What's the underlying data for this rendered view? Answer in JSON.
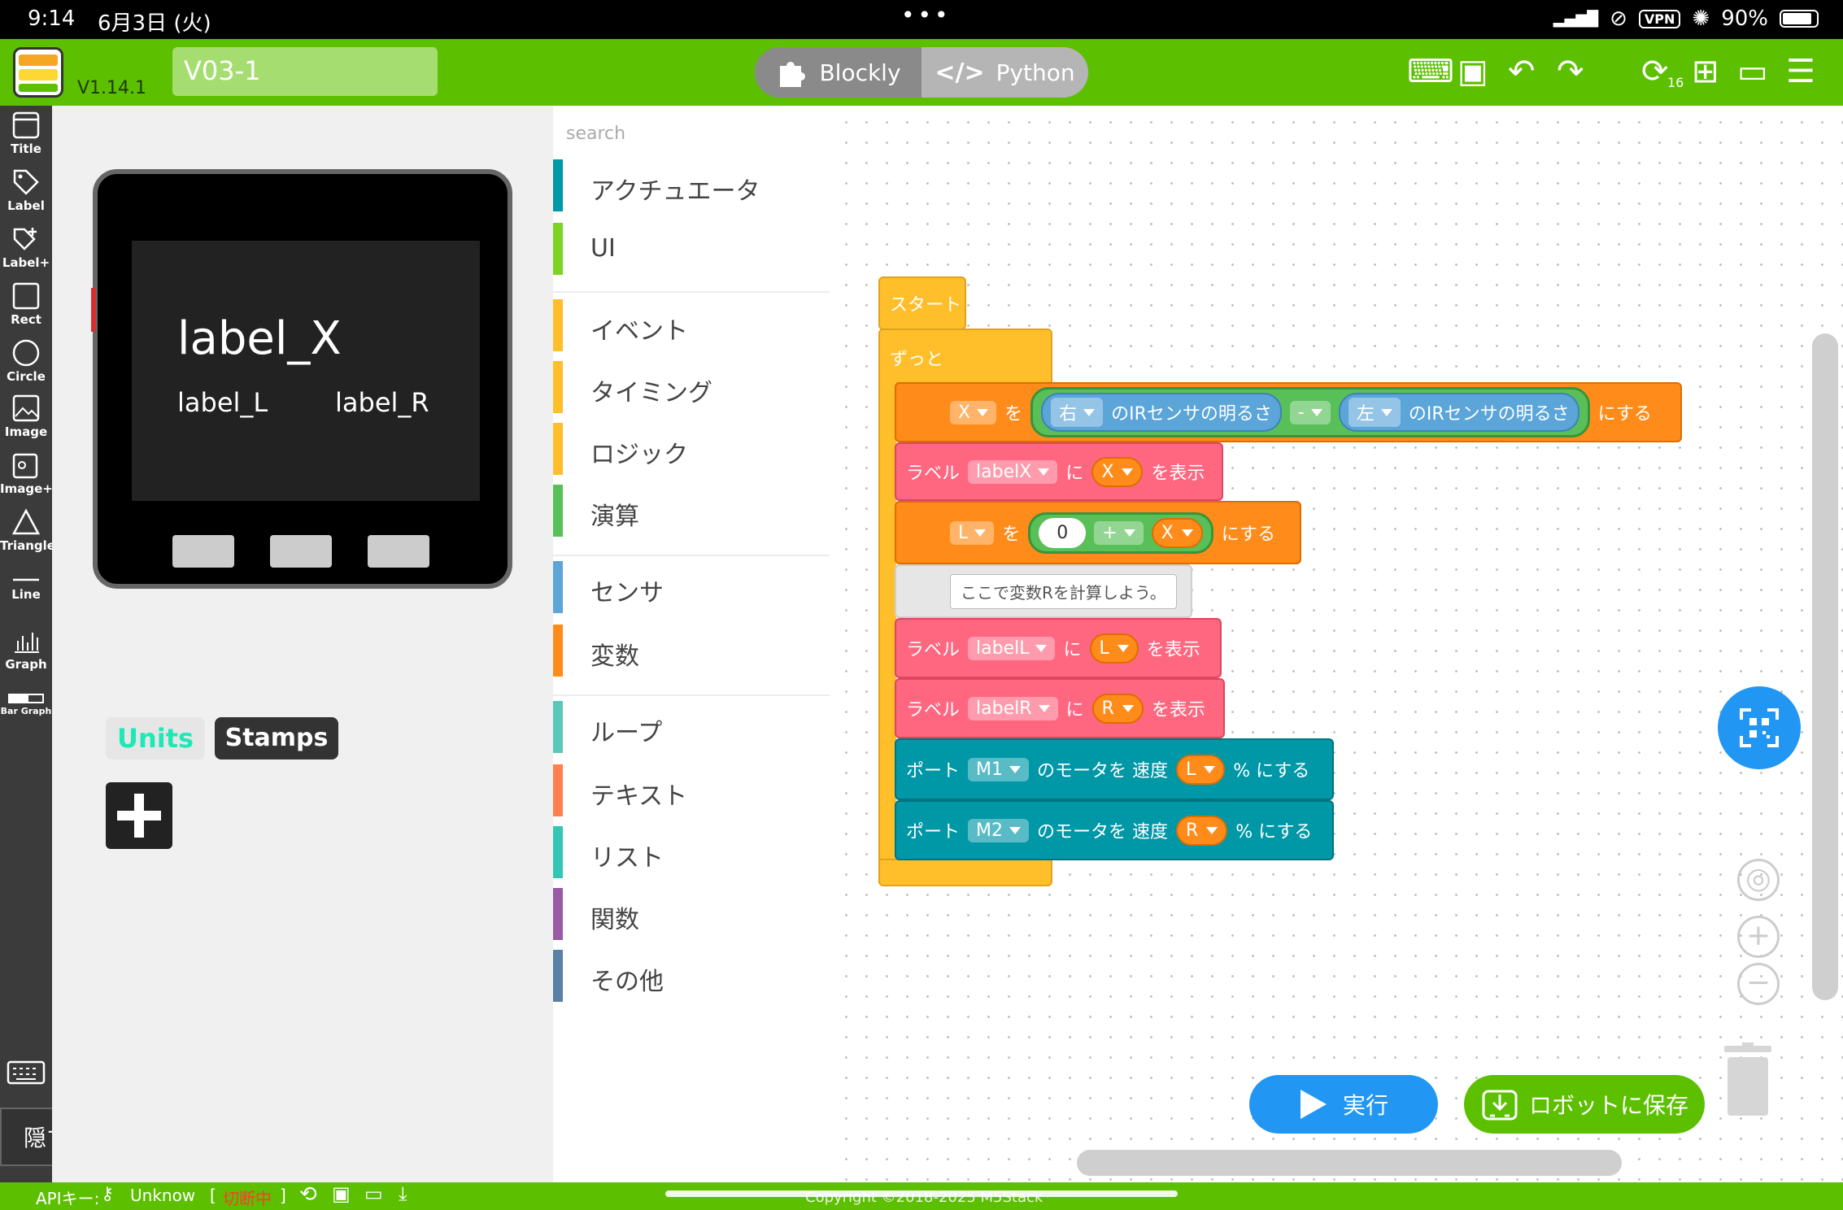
{
  "status_bar": {
    "time": "9:14",
    "date": "6月3日 (火)",
    "vpn": "VPN",
    "battery": "90%"
  },
  "header": {
    "version": "V1.14.1",
    "project_name": "V03-1",
    "mode_blockly": "Blockly",
    "mode_python": "Python",
    "history_count": "16"
  },
  "tools": {
    "title": "Title",
    "label": "Label",
    "label_plus": "Label+",
    "rect": "Rect",
    "circle": "Circle",
    "image": "Image",
    "image_plus": "Image+",
    "triangle": "Triangle",
    "line": "Line",
    "graph": "Graph",
    "bar_graph": "Bar Graph"
  },
  "hide_button": "隠す",
  "preview": {
    "label_x": "label_X",
    "label_l": "label_L",
    "label_r": "label_R",
    "tab_units": "Units",
    "tab_stamps": "Stamps"
  },
  "categories": {
    "search_placeholder": "search",
    "items": [
      "アクチュエータ",
      "UI",
      "イベント",
      "タイミング",
      "ロジック",
      "演算",
      "センサ",
      "変数",
      "ループ",
      "テキスト",
      "リスト",
      "関数",
      "その他"
    ],
    "colors": [
      "#0097a7",
      "#7ed321",
      "#ffbf2b",
      "#ffbf2b",
      "#ffbf2b",
      "#59c059",
      "#5ba5d9",
      "#ff8c1a",
      "#5ac8b8",
      "#ff7f50",
      "#34c6b4",
      "#995ba5",
      "#5b80a5"
    ]
  },
  "blocks": {
    "start": "スタート",
    "forever": "ずっと",
    "set": "を",
    "x_var": "X",
    "right": "右",
    "left": "左",
    "ir_brightness": "のIRセンサの明るさ",
    "minus": "-",
    "plus": "+",
    "make": "にする",
    "label": "ラベル",
    "label_x": "labelX",
    "label_l": "labelL",
    "label_r": "labelR",
    "ni": "に",
    "show": "を表示",
    "l_var": "L",
    "r_var": "R",
    "zero": "0",
    "comment": "ここで変数Rを計算しよう。",
    "port": "ポート",
    "m1": "M1",
    "m2": "M2",
    "motor_speed": "のモータを 速度",
    "percent_make": "% にする"
  },
  "actions": {
    "run": "実行",
    "save_robot": "ロボットに保存"
  },
  "footer": {
    "api_key": "APIキー:",
    "unknown": "Unknow",
    "disconnected": "切断中",
    "copyright": "Copyright ©2018-2025 M5Stack"
  }
}
